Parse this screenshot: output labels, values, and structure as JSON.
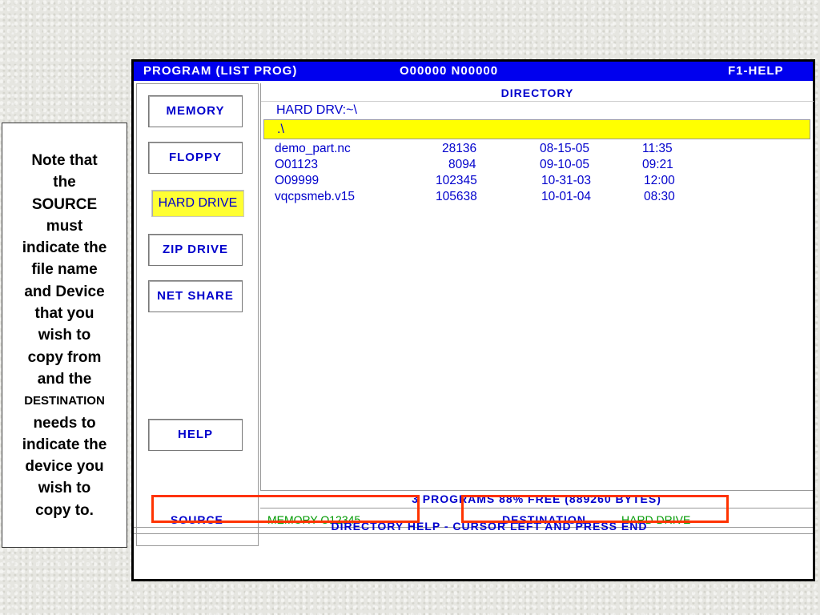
{
  "note": {
    "lines": [
      "Note that",
      "the",
      "SOURCE",
      "must",
      "indicate the",
      "file name",
      "and Device",
      "that you",
      "wish to",
      "copy from",
      "and the",
      "DESTINATION",
      "needs to",
      "indicate the",
      "device you",
      "wish to",
      "copy to."
    ]
  },
  "titlebar": {
    "mode": "PROGRAM  (LIST PROG)",
    "program": "O00000 N00000",
    "help": "F1-HELP"
  },
  "devices": {
    "memory": "MEMORY",
    "floppy": "FLOPPY",
    "hard_drive": "HARD DRIVE",
    "zip_drive": "ZIP DRIVE",
    "net_share": "NET SHARE",
    "help": "HELP",
    "selected": "HARD DRIVE"
  },
  "directory": {
    "title": "DIRECTORY",
    "path": "HARD DRV:~\\",
    "selected_entry": ".\\",
    "files": [
      {
        "name": "demo_part.nc",
        "size": "28136",
        "date": "08-15-05",
        "time": "11:35"
      },
      {
        "name": "O01123",
        "size": "8094",
        "date": "09-10-05",
        "time": "09:21"
      },
      {
        "name": "O09999",
        "size": "102345",
        "date": "10-31-03",
        "time": "12:00"
      },
      {
        "name": "vqcpsmeb.v15",
        "size": "105638",
        "date": "10-01-04",
        "time": "08:30"
      }
    ]
  },
  "status": "3 PROGRAMS 88% FREE (889260 BYTES)",
  "source": {
    "label": "SOURCE",
    "value": "MEMORY  O12345"
  },
  "destination": {
    "label": "DESTINATION",
    "value": "HARD DRIVE"
  },
  "help_line": "DIRECTORY HELP - CURSOR LEFT AND PRESS END",
  "colors": {
    "highlight_box": "#ff3300",
    "titlebar": "#0000ee",
    "selection": "#ffff00",
    "text": "#0000cc",
    "value": "#009900"
  }
}
